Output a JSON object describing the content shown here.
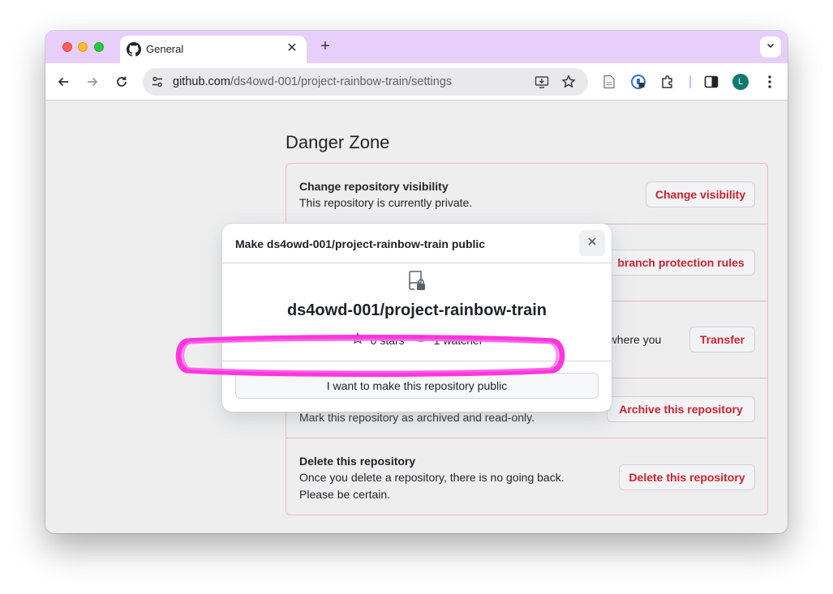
{
  "browser": {
    "tab_title": "General",
    "url_host": "github.com",
    "url_path": "/ds4owd-001/project-rainbow-train/settings",
    "avatar_letter": "L",
    "icons": [
      "github-icon",
      "close-icon",
      "plus-icon",
      "chevron-down-icon",
      "back-icon",
      "forward-icon",
      "reload-icon",
      "tune-icon",
      "install-icon",
      "bookmark-star-icon",
      "document-icon",
      "password-manager-icon",
      "extensions-icon",
      "side-panel-icon",
      "menu-icon"
    ]
  },
  "danger_zone": {
    "title": "Danger Zone",
    "rows": [
      {
        "title": "Change repository visibility",
        "desc": "This repository is currently private.",
        "button": "Change visibility"
      },
      {
        "title": "",
        "desc": "",
        "button": "branch protection rules"
      },
      {
        "title": "",
        "desc": "n where you",
        "button": "Transfer"
      },
      {
        "title": "",
        "desc": "Mark this repository as archived and read-only.",
        "button": "Archive this repository"
      },
      {
        "title": "Delete this repository",
        "desc_line1": "Once you delete a repository, there is no going back.",
        "desc_line2": "Please be certain.",
        "button": "Delete this repository"
      }
    ]
  },
  "modal": {
    "title": "Make ds4owd-001/project-rainbow-train public",
    "repo_name": "ds4owd-001/project-rainbow-train",
    "stars": "0 stars",
    "watchers": "1 watcher",
    "confirm_button": "I want to make this repository public"
  },
  "colors": {
    "tab_strip": "#e8cffb",
    "danger_text": "#cf222e",
    "highlight": "#ff2bdc"
  }
}
